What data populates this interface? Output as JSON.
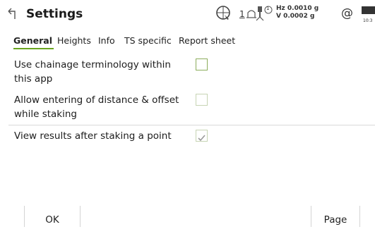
{
  "header": {
    "title": "Settings",
    "status": {
      "laser_number": "1",
      "prism_badge": "1",
      "hz_value": "Hz 0.0010 g",
      "v_value": "V  0.0002 g",
      "at_symbol": "@",
      "clock": "10:3"
    }
  },
  "tabs": [
    {
      "label": "General",
      "active": true
    },
    {
      "label": "Heights",
      "active": false
    },
    {
      "label": "Info",
      "active": false
    },
    {
      "label": "TS specific",
      "active": false
    },
    {
      "label": "Report sheet",
      "active": false
    }
  ],
  "options": [
    {
      "label_line1": "Use chainage terminology within",
      "label_line2": "this app",
      "checked": false,
      "enabled": true
    },
    {
      "label_line1": "Allow entering of distance & offset",
      "label_line2": "while staking",
      "checked": false,
      "enabled": false
    },
    {
      "label_line1": "View results after staking a point",
      "checked": true,
      "enabled": false
    }
  ],
  "footer": {
    "ok_label": "OK",
    "page_label": "Page"
  },
  "colors": {
    "accent": "#6aa51f",
    "checkbox_border": "#8cad5c",
    "checkbox_disabled_border": "#c7d4b4",
    "divider": "#d9d9d9"
  },
  "icons": [
    "back-arrow-icon",
    "target-icon",
    "laser-icon",
    "prism-icon",
    "battery-icon",
    "check-icon"
  ]
}
